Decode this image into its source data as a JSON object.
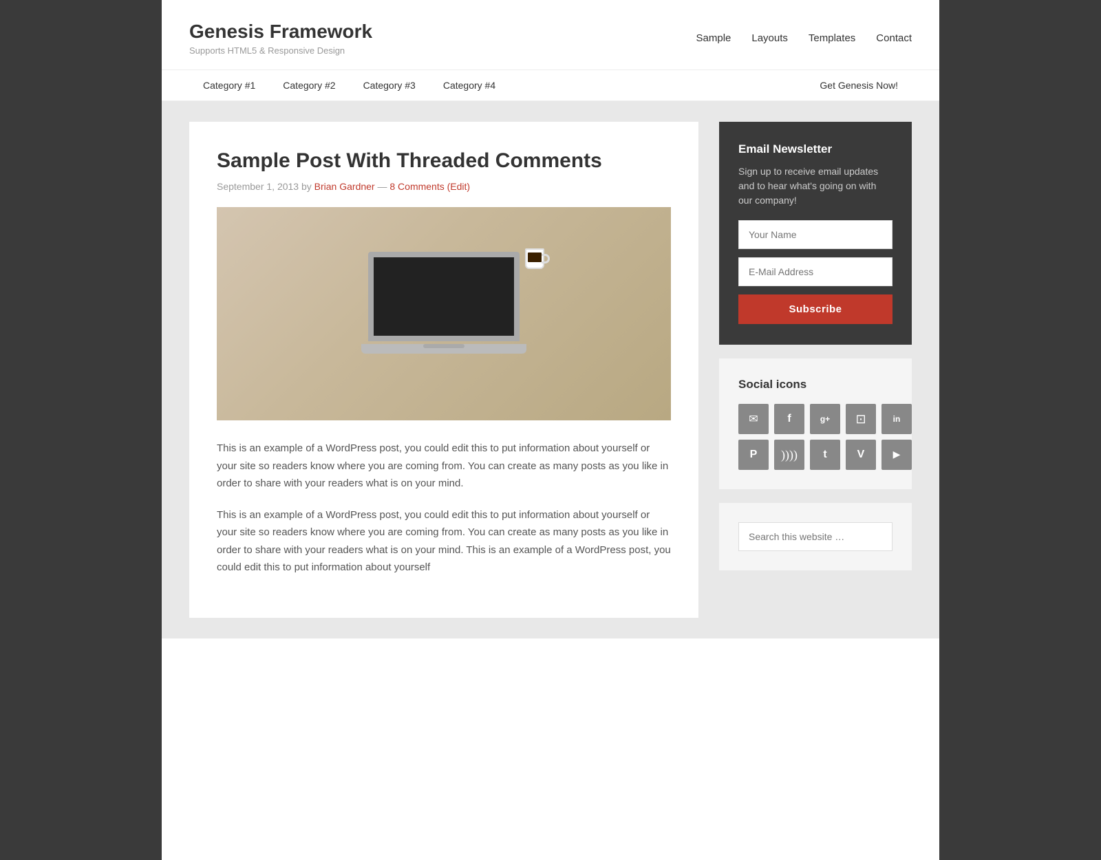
{
  "site": {
    "title": "Genesis Framework",
    "tagline": "Supports HTML5 & Responsive Design"
  },
  "main_nav": {
    "items": [
      {
        "label": "Sample",
        "href": "#"
      },
      {
        "label": "Layouts",
        "href": "#"
      },
      {
        "label": "Templates",
        "href": "#"
      },
      {
        "label": "Contact",
        "href": "#"
      }
    ]
  },
  "secondary_nav": {
    "left_items": [
      {
        "label": "Category #1",
        "href": "#"
      },
      {
        "label": "Category #2",
        "href": "#"
      },
      {
        "label": "Category #3",
        "href": "#"
      },
      {
        "label": "Category #4",
        "href": "#"
      }
    ],
    "right_item": {
      "label": "Get Genesis Now!",
      "href": "#"
    }
  },
  "post": {
    "title": "Sample Post With Threaded Comments",
    "meta": "September 1, 2013 by",
    "author": "Brian Gardner",
    "comments": "8 Comments (Edit)",
    "body_p1": "This is an example of a WordPress post, you could edit this to put information about yourself or your site so readers know where you are coming from. You can create as many posts as you like in order to share with your readers what is on your mind.",
    "body_p2": "This is an example of a WordPress post, you could edit this to put information about yourself or your site so readers know where you are coming from. You can create as many posts as you like in order to share with your readers what is on your mind. This is an example of a WordPress post, you could edit this to put information about yourself"
  },
  "sidebar": {
    "newsletter": {
      "title": "Email Newsletter",
      "description": "Sign up to receive email updates and to hear what's going on with our company!",
      "name_placeholder": "Your Name",
      "email_placeholder": "E-Mail Address",
      "button_label": "Subscribe"
    },
    "social": {
      "title": "Social icons",
      "icons": [
        {
          "name": "email-icon",
          "symbol": "✉"
        },
        {
          "name": "facebook-icon",
          "symbol": "f"
        },
        {
          "name": "google-plus-icon",
          "symbol": "g+"
        },
        {
          "name": "instagram-icon",
          "symbol": "📷"
        },
        {
          "name": "linkedin-icon",
          "symbol": "in"
        },
        {
          "name": "pinterest-icon",
          "symbol": "P"
        },
        {
          "name": "rss-icon",
          "symbol": "⌘"
        },
        {
          "name": "twitter-icon",
          "symbol": "t"
        },
        {
          "name": "vimeo-icon",
          "symbol": "V"
        },
        {
          "name": "youtube-icon",
          "symbol": "▶"
        }
      ]
    },
    "search": {
      "placeholder": "Search this website …"
    }
  },
  "colors": {
    "accent": "#c0392b",
    "dark_bg": "#3a3a3a",
    "light_bg": "#f5f5f5"
  }
}
